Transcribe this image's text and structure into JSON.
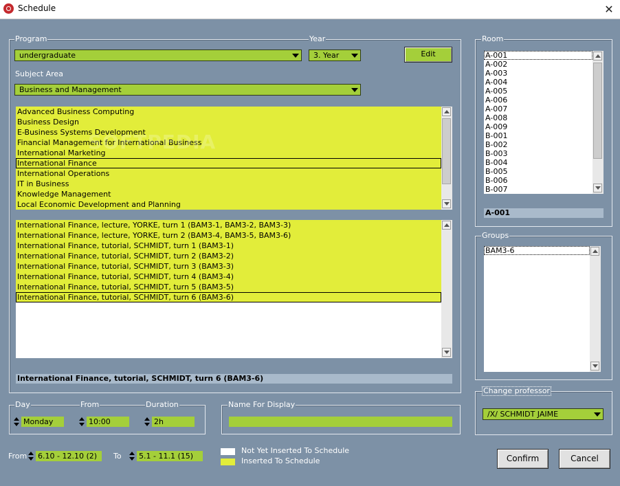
{
  "window": {
    "title": "Schedule",
    "close": "✕",
    "icon": "app-icon"
  },
  "program": {
    "label": "Program",
    "value": "undergraduate"
  },
  "year": {
    "label": "Year",
    "value": "3. Year"
  },
  "edit_button": "Edit",
  "subject_area": {
    "label": "Subject Area",
    "value": "Business and Management"
  },
  "courses": [
    "Advanced Business Computing",
    "Business Design",
    "E-Business Systems Development",
    "Financial Management for International Business",
    "International Marketing",
    "International Finance",
    "International Operations",
    "IT in Business",
    "Knowledge Management",
    "Local Economic Development and Planning"
  ],
  "courses_selected_index": 5,
  "turns": [
    "International Finance, lecture, YORKE, turn 1 (BAM3-1, BAM3-2, BAM3-3)",
    "International Finance, lecture, YORKE, turn 2 (BAM3-4, BAM3-5, BAM3-6)",
    "International Finance, tutorial, SCHMIDT, turn 1 (BAM3-1)",
    "International Finance, tutorial, SCHMIDT, turn 2 (BAM3-2)",
    "International Finance, tutorial, SCHMIDT, turn 3 (BAM3-3)",
    "International Finance, tutorial, SCHMIDT, turn 4 (BAM3-4)",
    "International Finance, tutorial, SCHMIDT, turn 5 (BAM3-5)",
    "International Finance, tutorial, SCHMIDT, turn 6 (BAM3-6)"
  ],
  "turns_selected_index": 7,
  "selected_turn_text": "International Finance, tutorial, SCHMIDT, turn 6 (BAM3-6)",
  "room": {
    "label": "Room",
    "items": [
      "A-001",
      "A-002",
      "A-003",
      "A-004",
      "A-005",
      "A-006",
      "A-007",
      "A-008",
      "A-009",
      "B-001",
      "B-002",
      "B-003",
      "B-004",
      "B-005",
      "B-006",
      "B-007"
    ],
    "selected": "A-001"
  },
  "groups": {
    "label": "Groups",
    "items": [
      "BAM3-6"
    ]
  },
  "professor": {
    "label": "Change professor",
    "value": "/X/ SCHMIDT JAIME"
  },
  "day": {
    "label": "Day",
    "value": "Monday"
  },
  "from": {
    "label": "From",
    "value": "10:00"
  },
  "duration": {
    "label": "Duration",
    "value": "2h"
  },
  "display_name": {
    "label": "Name For Display",
    "value": ""
  },
  "date_from": {
    "label": "From",
    "value": "6.10 - 12.10 (2)"
  },
  "date_to": {
    "label": "To",
    "value": "5.1 - 11.1 (15)"
  },
  "legend": [
    {
      "label": "Not Yet Inserted To Schedule",
      "color": "#ffffff"
    },
    {
      "label": "Inserted To Schedule",
      "color": "#e2ed3a"
    }
  ],
  "confirm_button": "Confirm",
  "cancel_button": "Cancel",
  "watermark": "SOFTPEDIA",
  "colors": {
    "background": "#7d91a6",
    "accent_green": "#a4cf3a",
    "list_yellow": "#e2ed3a"
  }
}
